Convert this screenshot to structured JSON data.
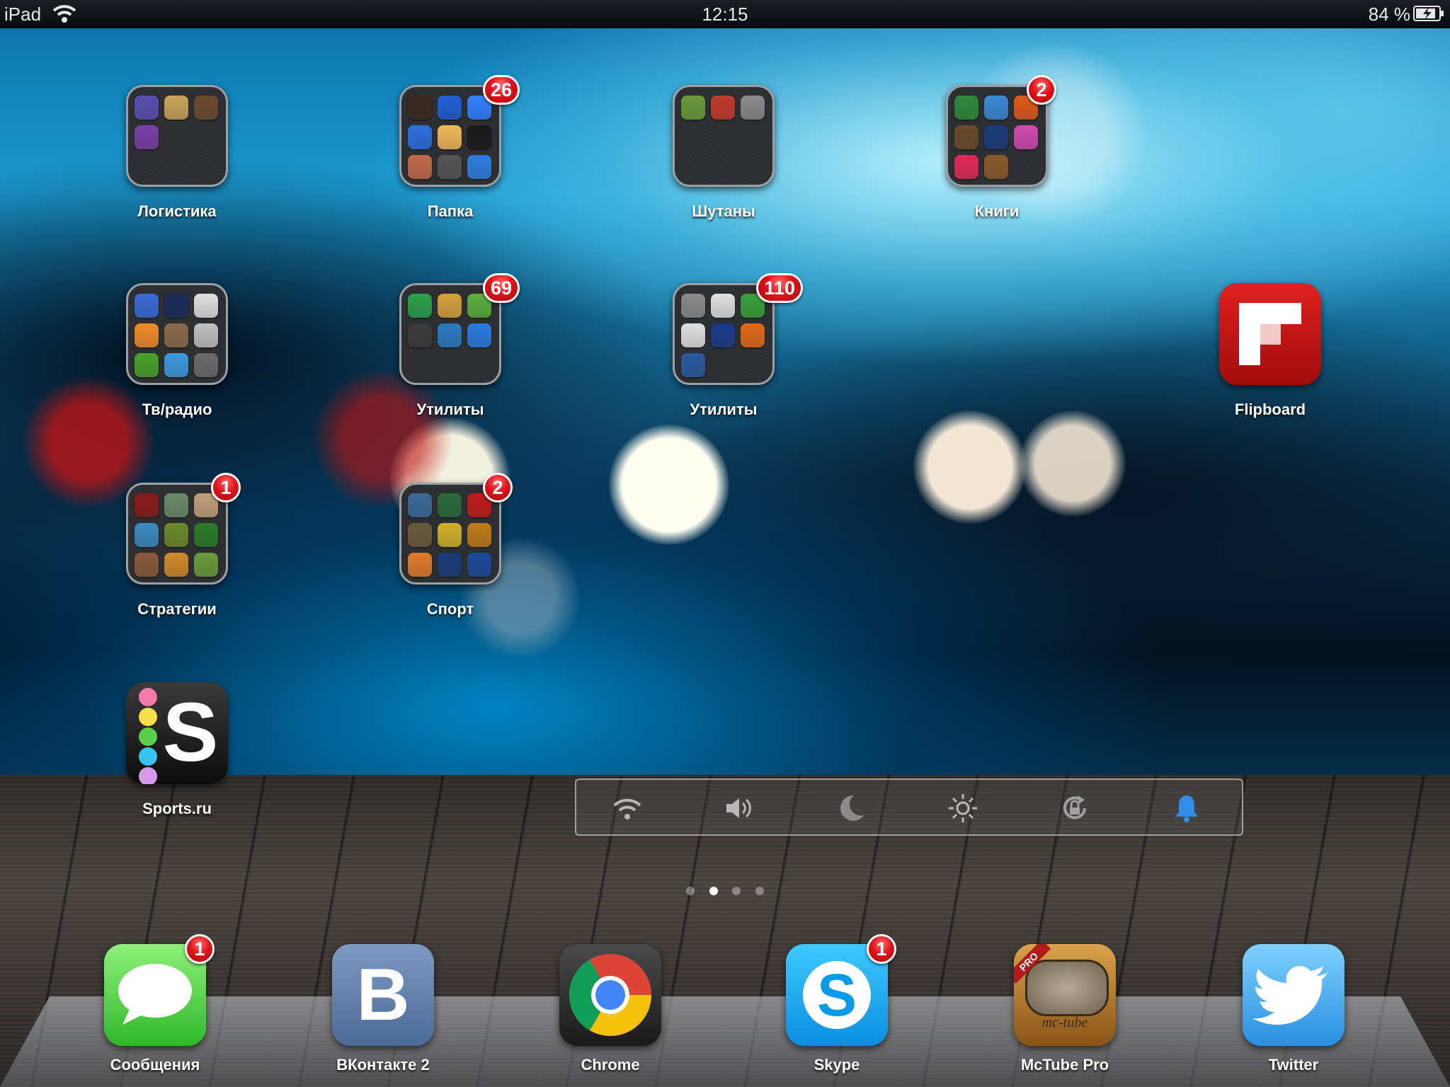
{
  "statusbar": {
    "device": "iPad",
    "time": "12:15",
    "battery": "84 %"
  },
  "folders": [
    {
      "id": "logistics",
      "label": "Логистика",
      "badge": "",
      "icons": [
        "#5a4fb0",
        "#c9a45a",
        "#6b4b2e",
        "#7a3fa8"
      ]
    },
    {
      "id": "papka",
      "label": "Папка",
      "badge": "26",
      "icons": [
        "#3a2a20",
        "#1f5fd6",
        "#2f80ff",
        "#2b6fe0",
        "#f0b95a",
        "#1a1a1a",
        "#c26a4a",
        "#555555",
        "#2f7de0"
      ]
    },
    {
      "id": "shutany",
      "label": "Шутаны",
      "badge": "",
      "icons": [
        "#6a9a3a",
        "#c23a2a",
        "#8a8a8a"
      ]
    },
    {
      "id": "knigi",
      "label": "Книги",
      "badge": "2",
      "icons": [
        "#2e8a3a",
        "#3a8ad6",
        "#e05a1a",
        "#6a4a2a",
        "#1a3a7a",
        "#d04ab0",
        "#e02a5a",
        "#8a5a2a"
      ]
    },
    {
      "id": "tv-radio",
      "label": "Тв/радио",
      "badge": "",
      "icons": [
        "#3a6ad6",
        "#1a2a5a",
        "#e0e0e0",
        "#f08a2a",
        "#8a6a4a",
        "#c0c0c0",
        "#4aa02a",
        "#3a9ae0",
        "#6a6a6a"
      ]
    },
    {
      "id": "utility-1",
      "label": "Утилиты",
      "badge": "69",
      "icons": [
        "#2aa04a",
        "#d6a03a",
        "#5ab03a",
        "#3a3a3a",
        "#2a7ac0",
        "#2a7ae0"
      ]
    },
    {
      "id": "utility-2",
      "label": "Утилиты",
      "badge": "110",
      "icons": [
        "#8a8a8a",
        "#e0e0e0",
        "#3aa03a",
        "#e0e0e0",
        "#1a3a8a",
        "#e06a1a",
        "#2a5aa0"
      ]
    },
    {
      "id": "strategy",
      "label": "Стратегии",
      "badge": "1",
      "icons": [
        "#8a1a1a",
        "#6a8a6a",
        "#c0a07a",
        "#3a8ac0",
        "#6a8a2a",
        "#2a7a2a",
        "#8a5a3a",
        "#d08a2a",
        "#6a9a3a"
      ]
    },
    {
      "id": "sport",
      "label": "Спорт",
      "badge": "2",
      "icons": [
        "#3a6a9a",
        "#2a6a3a",
        "#c01a1a",
        "#6a5a3a",
        "#d0b02a",
        "#c07a1a",
        "#e07a2a",
        "#1a3a7a",
        "#1a4a9a"
      ]
    }
  ],
  "apps": [
    {
      "id": "flipboard",
      "label": "Flipboard",
      "badge": ""
    },
    {
      "id": "sports-ru",
      "label": "Sports.ru",
      "badge": ""
    }
  ],
  "dock": [
    {
      "id": "messages",
      "label": "Сообщения",
      "badge": "1"
    },
    {
      "id": "vkontakte",
      "label": "ВКонтакте 2",
      "badge": ""
    },
    {
      "id": "chrome",
      "label": "Chrome",
      "badge": ""
    },
    {
      "id": "skype",
      "label": "Skype",
      "badge": "1"
    },
    {
      "id": "mctube",
      "label": "McTube Pro",
      "badge": ""
    },
    {
      "id": "twitter",
      "label": "Twitter",
      "badge": ""
    }
  ],
  "toggles": [
    {
      "id": "wifi",
      "icon": "wifi-icon"
    },
    {
      "id": "volume",
      "icon": "speaker-icon"
    },
    {
      "id": "dnd",
      "icon": "moon-icon"
    },
    {
      "id": "brightness",
      "icon": "sun-icon"
    },
    {
      "id": "rotation",
      "icon": "rotation-lock-icon"
    },
    {
      "id": "notifications",
      "icon": "bell-icon"
    }
  ],
  "pages": {
    "count": 4,
    "current": 2
  },
  "app_text": {
    "vk_letter": "B",
    "mctube_text": "mc-tube",
    "mctube_ribbon": "PRO",
    "skype_letter": "S",
    "sportsru_letter": "S"
  }
}
